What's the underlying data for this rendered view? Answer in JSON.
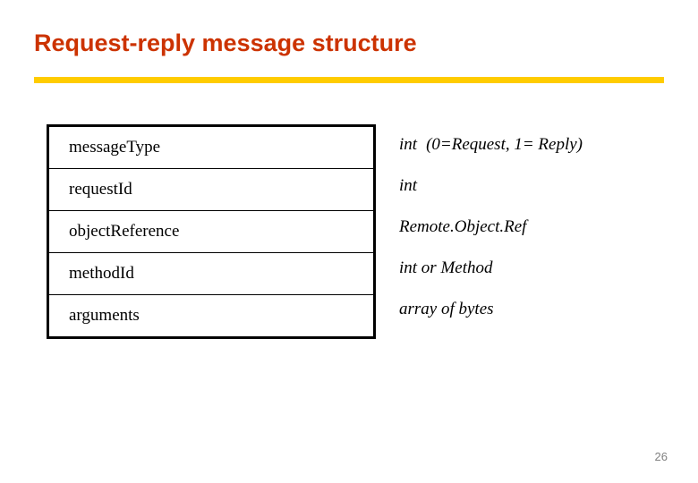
{
  "slide": {
    "title": "Request-reply message structure",
    "page_number": "26",
    "accent_color": "#cc3300",
    "rule_color": "#ffcc00",
    "fields": [
      {
        "name": "messageType",
        "type_main": "int",
        "type_note": "(0=Request, 1= Reply)"
      },
      {
        "name": "requestId",
        "type_main": "int",
        "type_note": ""
      },
      {
        "name": "objectReference",
        "type_main": "Remote.Object.Ref",
        "type_note": ""
      },
      {
        "name": "methodId",
        "type_main": "int or Method",
        "type_note": ""
      },
      {
        "name": "arguments",
        "type_main": "array of bytes",
        "type_note": ""
      }
    ]
  }
}
